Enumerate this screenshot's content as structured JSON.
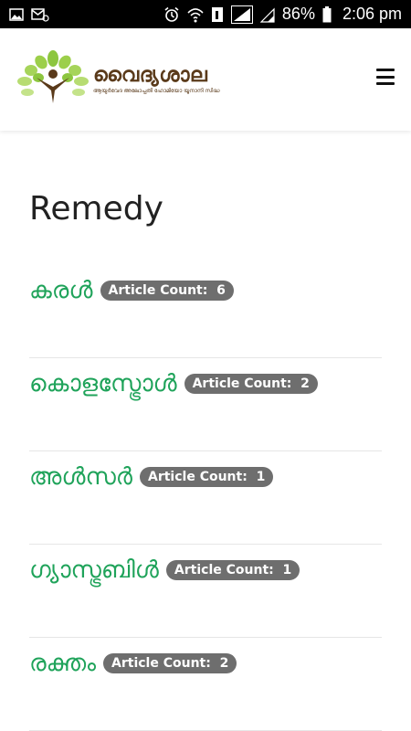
{
  "status_bar": {
    "icons_left": [
      "image-icon",
      "email-icon"
    ],
    "icons_right": [
      "alarm-icon",
      "wifi-icon",
      "sim-icon",
      "signal-icon",
      "signal2-icon",
      "battery-icon"
    ],
    "battery": "86%",
    "time": "2:06 pm"
  },
  "header": {
    "brand_name": "വൈദ്യശാല",
    "brand_tagline": "ആയുർവേദ അലോപ്പതി ഹോമിയോ യൂനാനി സിദ്ധ",
    "logo_icon": "tree-person-icon",
    "menu_icon": "hamburger-icon",
    "colors": {
      "leaf": "#8dc63f",
      "brand": "#5a3a1a"
    }
  },
  "main": {
    "title": "Remedy",
    "badge_prefix": "Article Count:  ",
    "items": [
      {
        "name": "കരൾ",
        "count": "6"
      },
      {
        "name": "കൊളസ്ട്രോൾ",
        "count": "2"
      },
      {
        "name": "അൾസർ",
        "count": "1"
      },
      {
        "name": "ഗ്യാസ്ട്രബിൾ",
        "count": "1"
      },
      {
        "name": "രക്തം",
        "count": "2"
      }
    ],
    "colors": {
      "link": "#1fa35a",
      "badge": "#6e6e6e"
    }
  }
}
